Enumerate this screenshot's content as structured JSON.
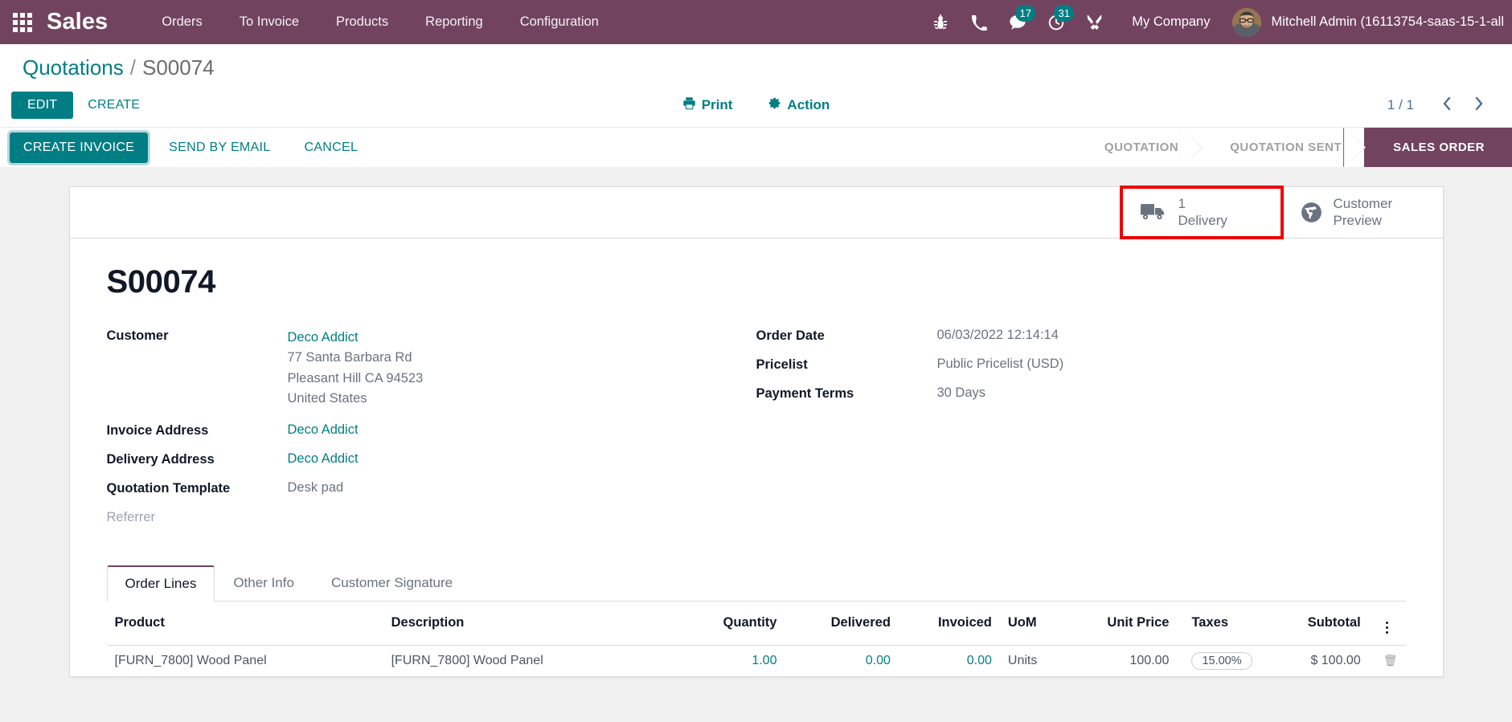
{
  "navbar": {
    "apps_icon": "apps-grid-icon",
    "brand": "Sales",
    "menu": [
      {
        "label": "Orders"
      },
      {
        "label": "To Invoice"
      },
      {
        "label": "Products"
      },
      {
        "label": "Reporting"
      },
      {
        "label": "Configuration"
      }
    ],
    "icons": [
      {
        "name": "bug-icon",
        "badge": null
      },
      {
        "name": "phone-icon",
        "badge": null
      },
      {
        "name": "messages-icon",
        "badge": "17"
      },
      {
        "name": "activity-clock-icon",
        "badge": "31"
      },
      {
        "name": "developer-tools-icon",
        "badge": null
      }
    ],
    "company": "My Company",
    "user": "Mitchell Admin (16113754-saas-15-1-all"
  },
  "breadcrumb": {
    "parent": "Quotations",
    "separator": "/",
    "current": "S00074"
  },
  "control_panel": {
    "edit_label": "EDIT",
    "create_label": "CREATE",
    "print_label": "Print",
    "action_label": "Action",
    "pager_count": "1 / 1",
    "prev_label": "‹",
    "next_label": "›"
  },
  "statusbar": {
    "create_invoice_label": "CREATE INVOICE",
    "send_by_email_label": "SEND BY EMAIL",
    "cancel_label": "CANCEL",
    "stages": [
      {
        "label": "QUOTATION",
        "active": false
      },
      {
        "label": "QUOTATION SENT",
        "active": false
      },
      {
        "label": "SALES ORDER",
        "active": true
      }
    ]
  },
  "smart_buttons": [
    {
      "icon": "delivery-truck-icon",
      "count": "1",
      "label": "Delivery",
      "highlighted": true
    },
    {
      "icon": "globe-icon",
      "count": "Customer",
      "label": "Preview",
      "highlighted": false
    }
  ],
  "record": {
    "title": "S00074",
    "left_fields": [
      {
        "label": "Customer",
        "value": "Deco Addict",
        "is_link": true,
        "address": [
          "77 Santa Barbara Rd",
          "Pleasant Hill CA 94523",
          "United States"
        ]
      },
      {
        "label": "Invoice Address",
        "value": "Deco Addict",
        "is_link": true
      },
      {
        "label": "Delivery Address",
        "value": "Deco Addict",
        "is_link": true
      },
      {
        "label": "Quotation Template",
        "value": "Desk pad",
        "is_link": false
      },
      {
        "label": "Referrer",
        "value": "",
        "is_link": false,
        "muted": true
      }
    ],
    "right_fields": [
      {
        "label": "Order Date",
        "value": "06/03/2022 12:14:14"
      },
      {
        "label": "Pricelist",
        "value": "Public Pricelist (USD)"
      },
      {
        "label": "Payment Terms",
        "value": "30 Days"
      }
    ]
  },
  "notebook": {
    "tabs": [
      {
        "label": "Order Lines",
        "active": true
      },
      {
        "label": "Other Info",
        "active": false
      },
      {
        "label": "Customer Signature",
        "active": false
      }
    ]
  },
  "order_lines": {
    "columns": [
      "Product",
      "Description",
      "Quantity",
      "Delivered",
      "Invoiced",
      "UoM",
      "Unit Price",
      "Taxes",
      "Subtotal"
    ],
    "optional_columns_icon": "vertical-dots-icon",
    "rows": [
      {
        "product": "[FURN_7800] Wood Panel",
        "description": "[FURN_7800] Wood Panel",
        "quantity": "1.00",
        "delivered": "0.00",
        "invoiced": "0.00",
        "uom": "Units",
        "unit_price": "100.00",
        "taxes": "15.00%",
        "subtotal": "$ 100.00"
      }
    ]
  },
  "colors": {
    "navbar": "#71435f",
    "primary": "#017e84",
    "highlight": "#ee0000",
    "stage_active": "#71435f"
  }
}
